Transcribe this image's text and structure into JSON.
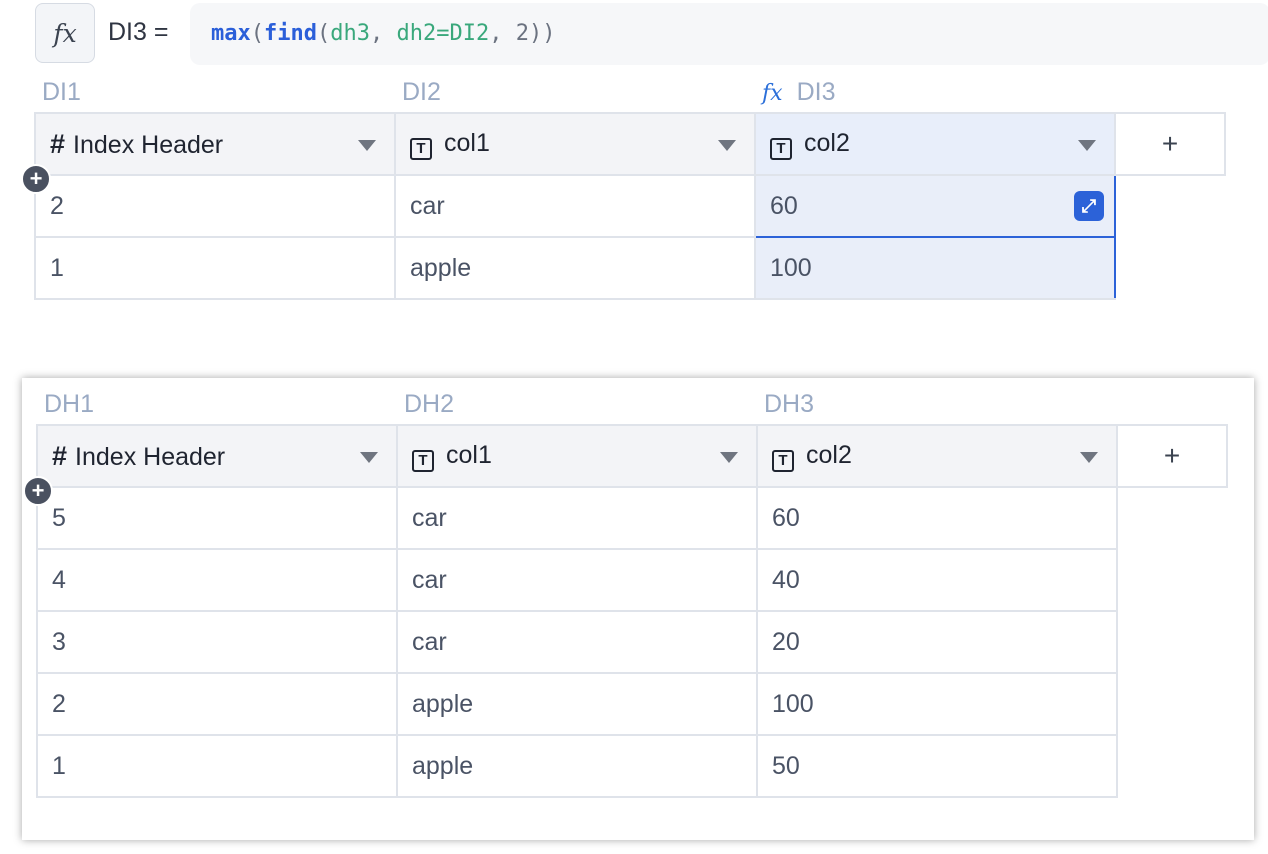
{
  "formula_bar": {
    "fx_label": "fx",
    "cell_ref": "DI3 =",
    "tokens": {
      "fn1": "max",
      "p1": "(",
      "fn2": "find",
      "p2": "(",
      "arg1": "dh3",
      "c1": ", ",
      "arg2": "dh2=DI2",
      "c2": ", ",
      "arg3": "2",
      "p3": "))"
    }
  },
  "table_top": {
    "col_labels": [
      "DI1",
      "DI2",
      "DI3"
    ],
    "formula_marker": "fx",
    "headers": [
      "Index Header",
      "col1",
      "col2"
    ],
    "add_column": "+",
    "rows": [
      [
        "2",
        "car",
        "60"
      ],
      [
        "1",
        "apple",
        "100"
      ]
    ]
  },
  "table_bottom": {
    "col_labels": [
      "DH1",
      "DH2",
      "DH3"
    ],
    "headers": [
      "Index Header",
      "col1",
      "col2"
    ],
    "add_column": "+",
    "rows": [
      [
        "5",
        "car",
        "60"
      ],
      [
        "4",
        "car",
        "40"
      ],
      [
        "3",
        "car",
        "20"
      ],
      [
        "2",
        "apple",
        "100"
      ],
      [
        "1",
        "apple",
        "50"
      ]
    ]
  },
  "icons": {
    "hash": "#",
    "text_type": "T",
    "add_row": "+",
    "expand": "⤢"
  },
  "colors": {
    "selection": "#2c62d8",
    "formula_fn": "#2b5fd9",
    "formula_arg": "#3aa87c",
    "column_label": "#9aaac4"
  }
}
